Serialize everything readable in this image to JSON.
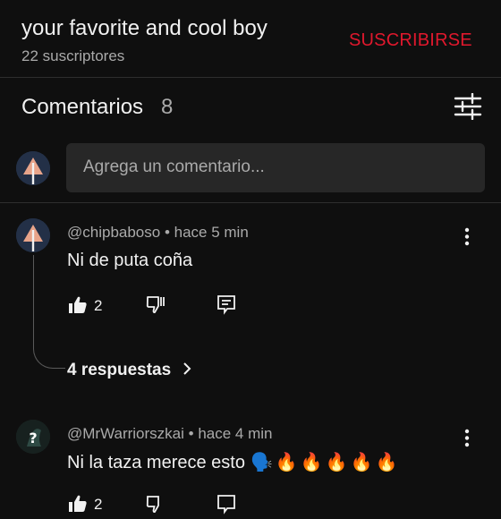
{
  "header": {
    "channel_name": "your favorite and cool boy",
    "subscribers": "22 suscriptores",
    "subscribe_label": "SUSCRIBIRSE"
  },
  "comments_section": {
    "title": "Comentarios",
    "count": "8",
    "filter_icon": "sort-icon",
    "input_placeholder": "Agrega un comentario..."
  },
  "comments": [
    {
      "author": "@chipbaboso",
      "time": "• hace 5 min",
      "text": "Ni de puta coña",
      "likes": "2",
      "replies_label": "4 respuestas",
      "avatar_icon": "warning-icon"
    },
    {
      "author": "@MrWarriorszkai",
      "time": "• hace 4 min",
      "text": "Ni la taza merece esto",
      "emojis": [
        "🗣️",
        "🔥",
        "🔥",
        "🔥",
        "🔥",
        "🔥"
      ],
      "likes": "2",
      "avatar_icon": "question-icon"
    }
  ],
  "colors": {
    "background": "#0f0f0f",
    "subscribe": "#e0182d",
    "input": "#272727",
    "muted": "#aaaaaa"
  }
}
